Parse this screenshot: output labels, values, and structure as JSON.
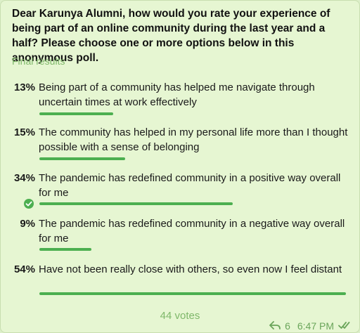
{
  "poll": {
    "question": "Dear Karunya Alumni, how would you rate your experience of being part of an online community during the last year and a half? Please choose one or more options below in this anonymous poll.",
    "status_label": "Final results",
    "votes_label": "44 votes",
    "options": [
      {
        "percent_label": "13%",
        "percent": 13,
        "text": "Being part of a community has helped me navigate through uncertain times at work effectively",
        "bar_fraction": 0.24,
        "selected": false
      },
      {
        "percent_label": "15%",
        "percent": 15,
        "text": "The community has helped in my personal life more than I thought possible with a sense of belonging",
        "bar_fraction": 0.28,
        "selected": false
      },
      {
        "percent_label": "34%",
        "percent": 34,
        "text": "The pandemic has redefined community in a positive way overall for me",
        "bar_fraction": 0.63,
        "selected": true
      },
      {
        "percent_label": "9%",
        "percent": 9,
        "text": "The pandemic has redefined community in a negative way overall for me",
        "bar_fraction": 0.17,
        "selected": false
      },
      {
        "percent_label": "54%",
        "percent": 54,
        "text": "Have not been really close with others, so even now I feel distant",
        "bar_fraction": 1.0,
        "selected": false
      }
    ]
  },
  "message_meta": {
    "forward_icon": "reply-icon",
    "forward_count": "6",
    "time": "6:47 PM",
    "read_icon": "double-check-icon"
  },
  "colors": {
    "accent": "#4caf50",
    "muted_green": "#7fb86a",
    "bubble_bg": "#e6f6d2"
  }
}
